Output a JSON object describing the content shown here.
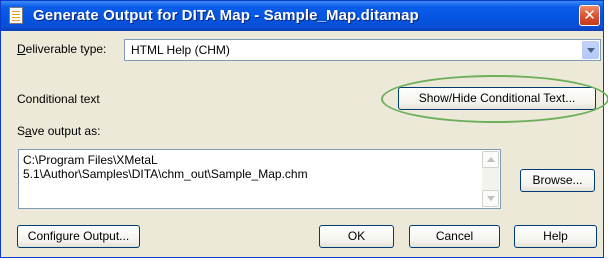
{
  "window": {
    "title": "Generate Output for DITA Map - Sample_Map.ditamap",
    "close_glyph": "✕"
  },
  "deliverable": {
    "label_accel": "D",
    "label_rest": "eliverable type:",
    "value": "HTML Help (CHM)"
  },
  "conditional": {
    "label": "Conditional text",
    "button": "Show/Hide Conditional Text..."
  },
  "save": {
    "label_first": "S",
    "label_accel": "a",
    "label_rest": "ve output as:",
    "path_line1": "C:\\Program Files\\XMetaL",
    "path_line2": "5.1\\Author\\Samples\\DITA\\chm_out\\Sample_Map.chm",
    "browse_button": "Browse..."
  },
  "footer": {
    "configure_button": "Configure Output...",
    "ok_button": "OK",
    "cancel_button": "Cancel",
    "help_button": "Help"
  },
  "colors": {
    "highlight": "#6cae5a",
    "titlebar": "#0453e0",
    "dialog_bg": "#ece9d8"
  },
  "icons": {
    "title": "document-icon",
    "dropdown": "chevron-down-icon"
  }
}
